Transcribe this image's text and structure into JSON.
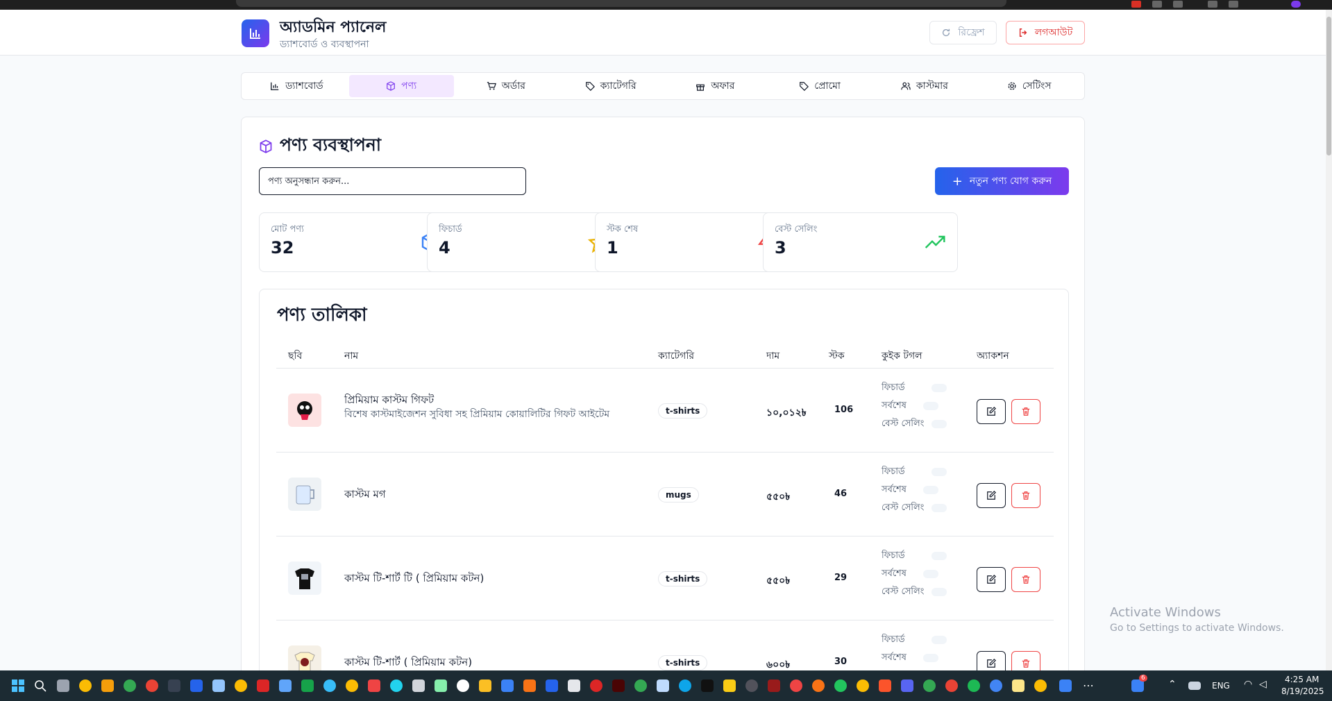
{
  "header": {
    "title": "অ্যাডমিন প্যানেল",
    "subtitle": "ড্যাশবোর্ড ও ব্যবস্থাপনা",
    "refresh_label": "রিফ্রেশ",
    "logout_label": "লগআউট"
  },
  "nav": {
    "tabs": [
      {
        "label": "ড্যাশবোর্ড",
        "icon": "bar-chart-icon",
        "active": false
      },
      {
        "label": "পণ্য",
        "icon": "package-icon",
        "active": true
      },
      {
        "label": "অর্ডার",
        "icon": "cart-icon",
        "active": false
      },
      {
        "label": "ক্যাটেগরি",
        "icon": "tag-icon",
        "active": false
      },
      {
        "label": "অফার",
        "icon": "gift-icon",
        "active": false
      },
      {
        "label": "প্রোমো",
        "icon": "tag-icon",
        "active": false
      },
      {
        "label": "কাস্টমার",
        "icon": "users-icon",
        "active": false
      },
      {
        "label": "সেটিংস",
        "icon": "gear-icon",
        "active": false
      }
    ]
  },
  "products": {
    "section_title": "পণ্য ব্যবস্থাপনা",
    "search_placeholder": "পণ্য অনুসন্ধান করুন...",
    "add_button_label": "নতুন পণ্য যোগ করুন",
    "stats": [
      {
        "label": "মোট পণ্য",
        "value": "32",
        "icon": "box-icon",
        "color": "#3b82f6"
      },
      {
        "label": "ফিচার্ড",
        "value": "4",
        "icon": "star-icon",
        "color": "#eab308"
      },
      {
        "label": "স্টক শেষ",
        "value": "1",
        "icon": "lightning-icon",
        "color": "#ef4444"
      },
      {
        "label": "বেস্ট সেলিং",
        "value": "3",
        "icon": "trending-up-icon",
        "color": "#22c55e"
      }
    ],
    "table": {
      "title": "পণ্য তালিকা",
      "headers": {
        "image": "ছবি",
        "name": "নাম",
        "category": "ক্যাটেগরি",
        "price": "দাম",
        "stock": "স্টক",
        "quick_toggle": "কুইক টগল",
        "actions": "অ্যাকশন"
      },
      "toggle_labels": {
        "featured": "ফিচার্ড",
        "latest": "সর্বশেষ",
        "best_selling": "বেস্ট সেলিং"
      },
      "rows": [
        {
          "name": "প্রিমিয়াম কাস্টম গিফট",
          "description": "বিশেষ কাস্টমাইজেশন সুবিধা সহ প্রিমিয়াম কোয়ালিটির গিফট আইটেম",
          "category": "t-shirts",
          "price": "১০,০১২৳",
          "stock": "106"
        },
        {
          "name": "কাস্টম মগ",
          "description": "",
          "category": "mugs",
          "price": "৫৫০৳",
          "stock": "46"
        },
        {
          "name": "কাস্টম টি-শার্ট টি ( প্রিমিয়াম কটন)",
          "description": "",
          "category": "t-shirts",
          "price": "৫৫০৳",
          "stock": "29"
        },
        {
          "name": "কাস্টম টি-শার্ট ( প্রিমিয়াম কটন)",
          "description": "",
          "category": "t-shirts",
          "price": "৬০০৳",
          "stock": "30"
        }
      ]
    }
  },
  "watermark": {
    "line1": "Activate Windows",
    "line2": "Go to Settings to activate Windows."
  },
  "taskbar": {
    "language": "ENG",
    "time": "4:25 AM",
    "date": "8/19/2025",
    "notification_count": "6"
  }
}
